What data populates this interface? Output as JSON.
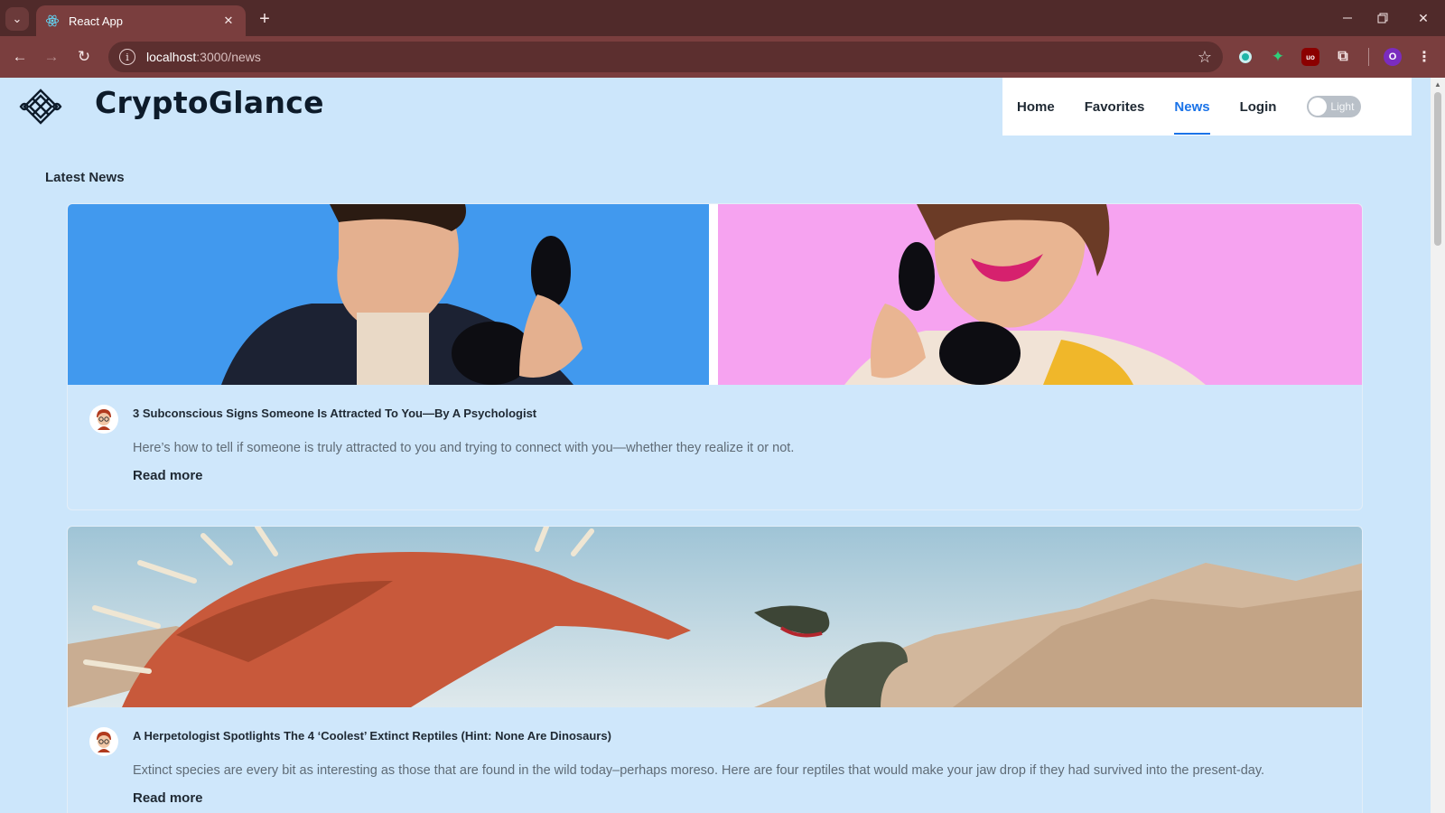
{
  "browser": {
    "tab_title": "React App",
    "url_host": "localhost",
    "url_path": ":3000/news",
    "profile_initial": "O",
    "ublock_label": "uo"
  },
  "site": {
    "brand": "CryptoGlance",
    "nav": {
      "home": "Home",
      "favorites": "Favorites",
      "news": "News",
      "login": "Login",
      "active": "News"
    },
    "theme_toggle": {
      "label": "Light",
      "on": false
    }
  },
  "news": {
    "section_title": "Latest News",
    "read_more_label": "Read more",
    "articles": [
      {
        "title": "3 Subconscious Signs Someone Is Attracted To You—By A Psychologist",
        "description": "Here’s how to tell if someone is truly attracted to you and trying to connect with you—whether they realize it or not."
      },
      {
        "title": "A Herpetologist Spotlights The 4 ‘Coolest’ Extinct Reptiles (Hint: None Are Dinosaurs)",
        "description": "Extinct species are every bit as interesting as those that are found in the wild today–perhaps moreso. Here are four reptiles that would make your jaw drop if they had survived into the present-day."
      }
    ]
  },
  "colors": {
    "page_bg": "#cce6fb",
    "accent": "#1a73e8",
    "chrome_dark": "#502a2a",
    "chrome_toolbar": "#7a3e3e"
  }
}
